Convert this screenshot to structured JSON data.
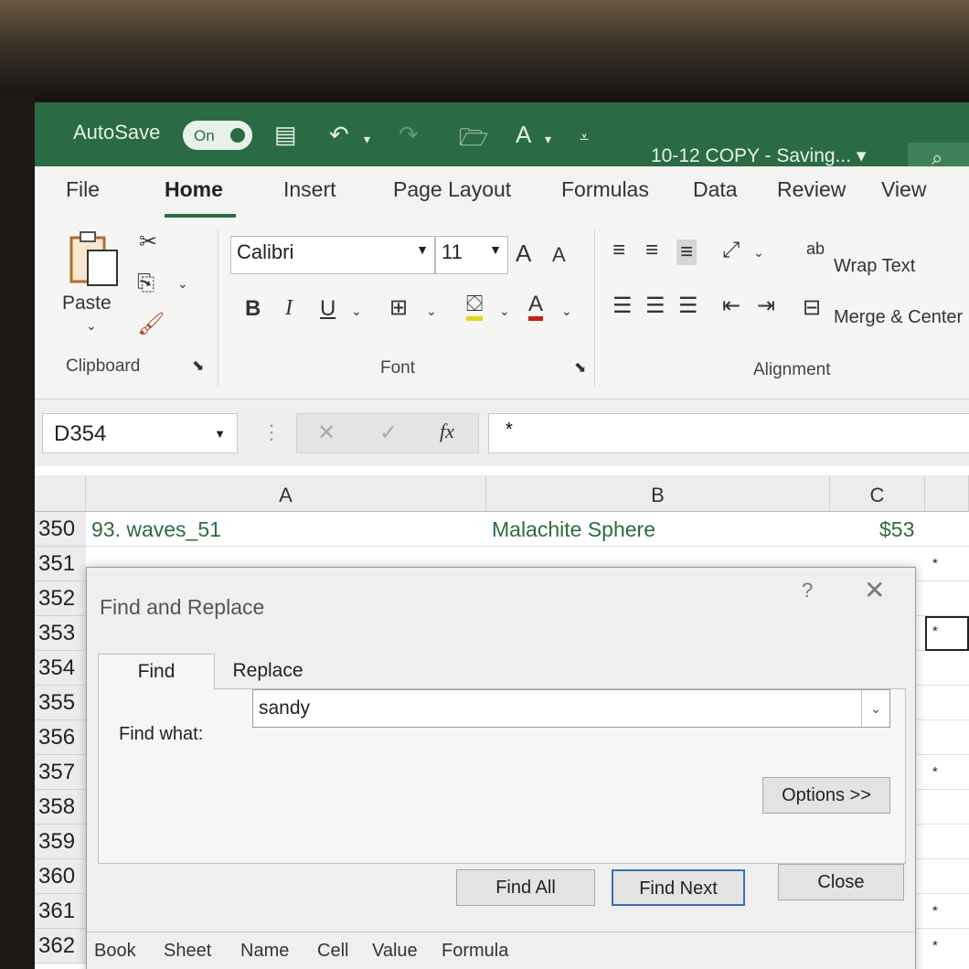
{
  "titlebar": {
    "autosave_label": "AutoSave",
    "autosave_state": "On",
    "font_color_icon_letter": "A",
    "document_title": "10-12 COPY  -  Saving... ▾"
  },
  "tabs": [
    "File",
    "Home",
    "Insert",
    "Page Layout",
    "Formulas",
    "Data",
    "Review",
    "View"
  ],
  "ribbon": {
    "paste_label": "Paste",
    "clipboard_label": "Clipboard",
    "font_name": "Calibri",
    "font_size": "11",
    "grow_font": "A",
    "shrink_font": "A",
    "bold": "B",
    "italic": "I",
    "underline": "U",
    "font_color_letter": "A",
    "font_label": "Font",
    "wrap_text": "Wrap Text",
    "merge_center": "Merge & Center",
    "alignment_label": "Alignment"
  },
  "formula_bar": {
    "name_box": "D354",
    "fx_label": "fx",
    "formula": "*"
  },
  "grid": {
    "columns": [
      "A",
      "B",
      "C"
    ],
    "rows": [
      "350",
      "351",
      "352",
      "353",
      "354",
      "355",
      "356",
      "357",
      "358",
      "359",
      "360",
      "361",
      "362"
    ],
    "row350": {
      "a": "93. waves_51",
      "b": "Malachite Sphere",
      "c": "$53"
    },
    "star": "*"
  },
  "dialog": {
    "title": "Find and Replace",
    "help": "?",
    "tab_find": "Find",
    "tab_replace": "Replace",
    "find_what_label": "Find what:",
    "find_what_value": "sandy",
    "options_button": "Options >>",
    "find_all_button": "Find All",
    "find_next_button": "Find Next",
    "close_button": "Close",
    "result_columns": [
      "Book",
      "Sheet",
      "Name",
      "Cell",
      "Value",
      "Formula"
    ]
  }
}
